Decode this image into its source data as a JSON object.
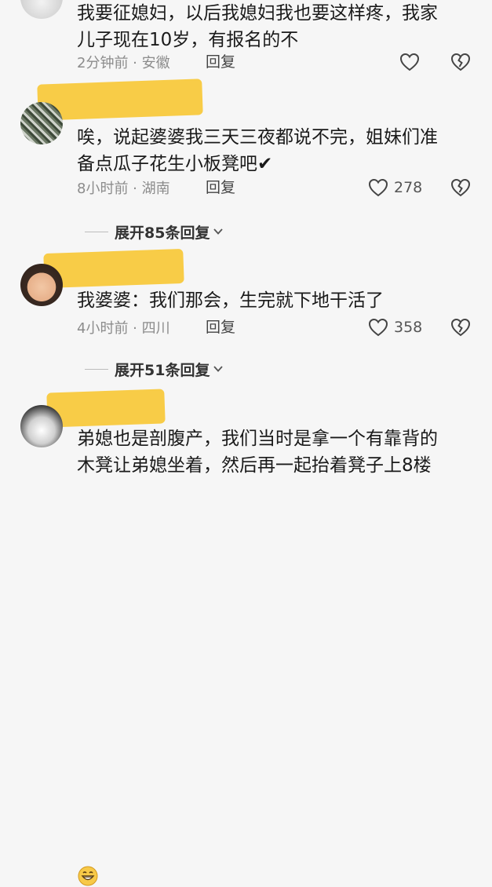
{
  "comments": [
    {
      "text": "我要征媳妇，以后我媳妇我也要这样疼，我家\n儿子现在10岁，有报名的不",
      "time_location": "2分钟前 · 安徽",
      "reply_label": "回复",
      "likes": ""
    },
    {
      "text": "唉，说起婆婆我三天三夜都说不完，姐妹们准\n备点瓜子花生小板凳吧✔",
      "time_location": "8小时前 · 湖南",
      "reply_label": "回复",
      "likes": "278"
    },
    {
      "text": "我婆婆：我们那会，生完就下地干活了",
      "time_location": "4小时前 · 四川",
      "reply_label": "回复",
      "likes": "358"
    },
    {
      "text": "弟媳也是剖腹产，我们当时是拿一个有靠背的\n木凳让弟媳坐着，然后再一起抬着凳子上8楼",
      "time_location": "",
      "reply_label": "",
      "likes": ""
    }
  ],
  "expand_replies": [
    {
      "label": "展开85条回复"
    },
    {
      "label": "展开51条回复"
    }
  ],
  "icons": {
    "like": "heart-outline-icon",
    "dislike": "broken-heart-icon",
    "expand": "chevron-down-icon",
    "emoji": "grinning-face-emoji"
  },
  "colors": {
    "background": "#f6f6f6",
    "name_mask": "#f8c93d",
    "meta_text": "#8c8c8c"
  }
}
